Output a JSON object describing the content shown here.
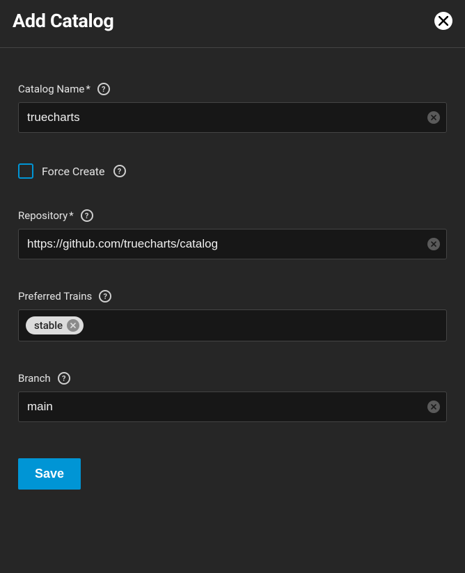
{
  "header": {
    "title": "Add Catalog"
  },
  "fields": {
    "catalog_name": {
      "label": "Catalog Name",
      "required_mark": "*",
      "value": "truecharts"
    },
    "force_create": {
      "label": "Force Create"
    },
    "repository": {
      "label": "Repository",
      "required_mark": "*",
      "value": "https://github.com/truecharts/catalog"
    },
    "preferred_trains": {
      "label": "Preferred Trains",
      "chips": [
        "stable"
      ]
    },
    "branch": {
      "label": "Branch",
      "value": "main"
    }
  },
  "footer": {
    "save_label": "Save"
  },
  "help_glyph": "?"
}
